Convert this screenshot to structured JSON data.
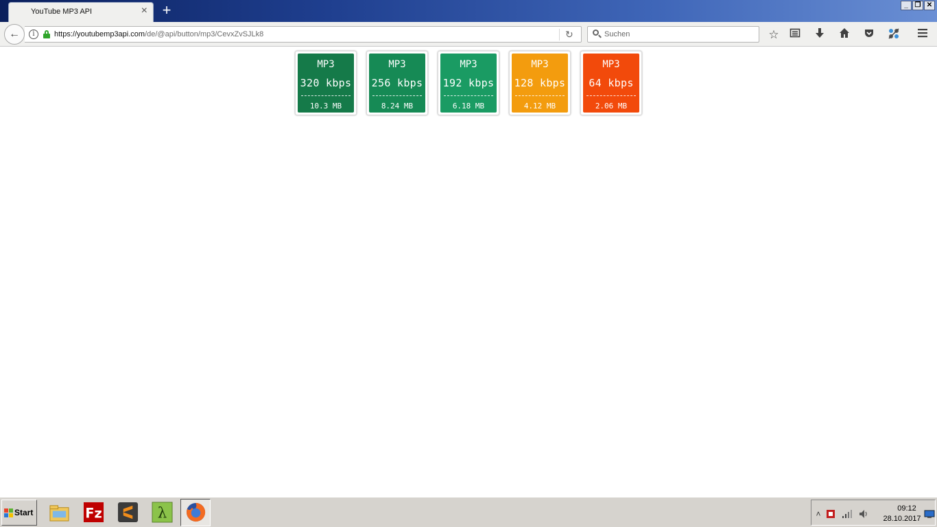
{
  "browser": {
    "tab_title": "YouTube MP3 API",
    "tab_close": "×",
    "new_tab": "+",
    "url_host": "https://youtubemp3api.com",
    "url_path": "/de/@api/button/mp3/CevxZvSJLk8",
    "search_placeholder": "Suchen",
    "window_controls": {
      "minimize": "_",
      "restore": "❐",
      "close": "✕"
    }
  },
  "quality_buttons": [
    {
      "format": "MP3",
      "bitrate": "320 kbps",
      "size": "10.3 MB",
      "color": "#157a49"
    },
    {
      "format": "MP3",
      "bitrate": "256 kbps",
      "size": "8.24 MB",
      "color": "#168a55"
    },
    {
      "format": "MP3",
      "bitrate": "192 kbps",
      "size": "6.18 MB",
      "color": "#1a9b63"
    },
    {
      "format": "MP3",
      "bitrate": "128 kbps",
      "size": "4.12 MB",
      "color": "#f39c0e"
    },
    {
      "format": "MP3",
      "bitrate": "64 kbps",
      "size": "2.06 MB",
      "color": "#f24a0b"
    }
  ],
  "taskbar": {
    "start_label": "Start",
    "clock_time": "09:12",
    "clock_date": "28.10.2017"
  },
  "colors": {
    "titlebar_dark": "#0a1f5c",
    "titlebar_light": "#6a8fd4",
    "lock_green": "#2fa52a"
  }
}
